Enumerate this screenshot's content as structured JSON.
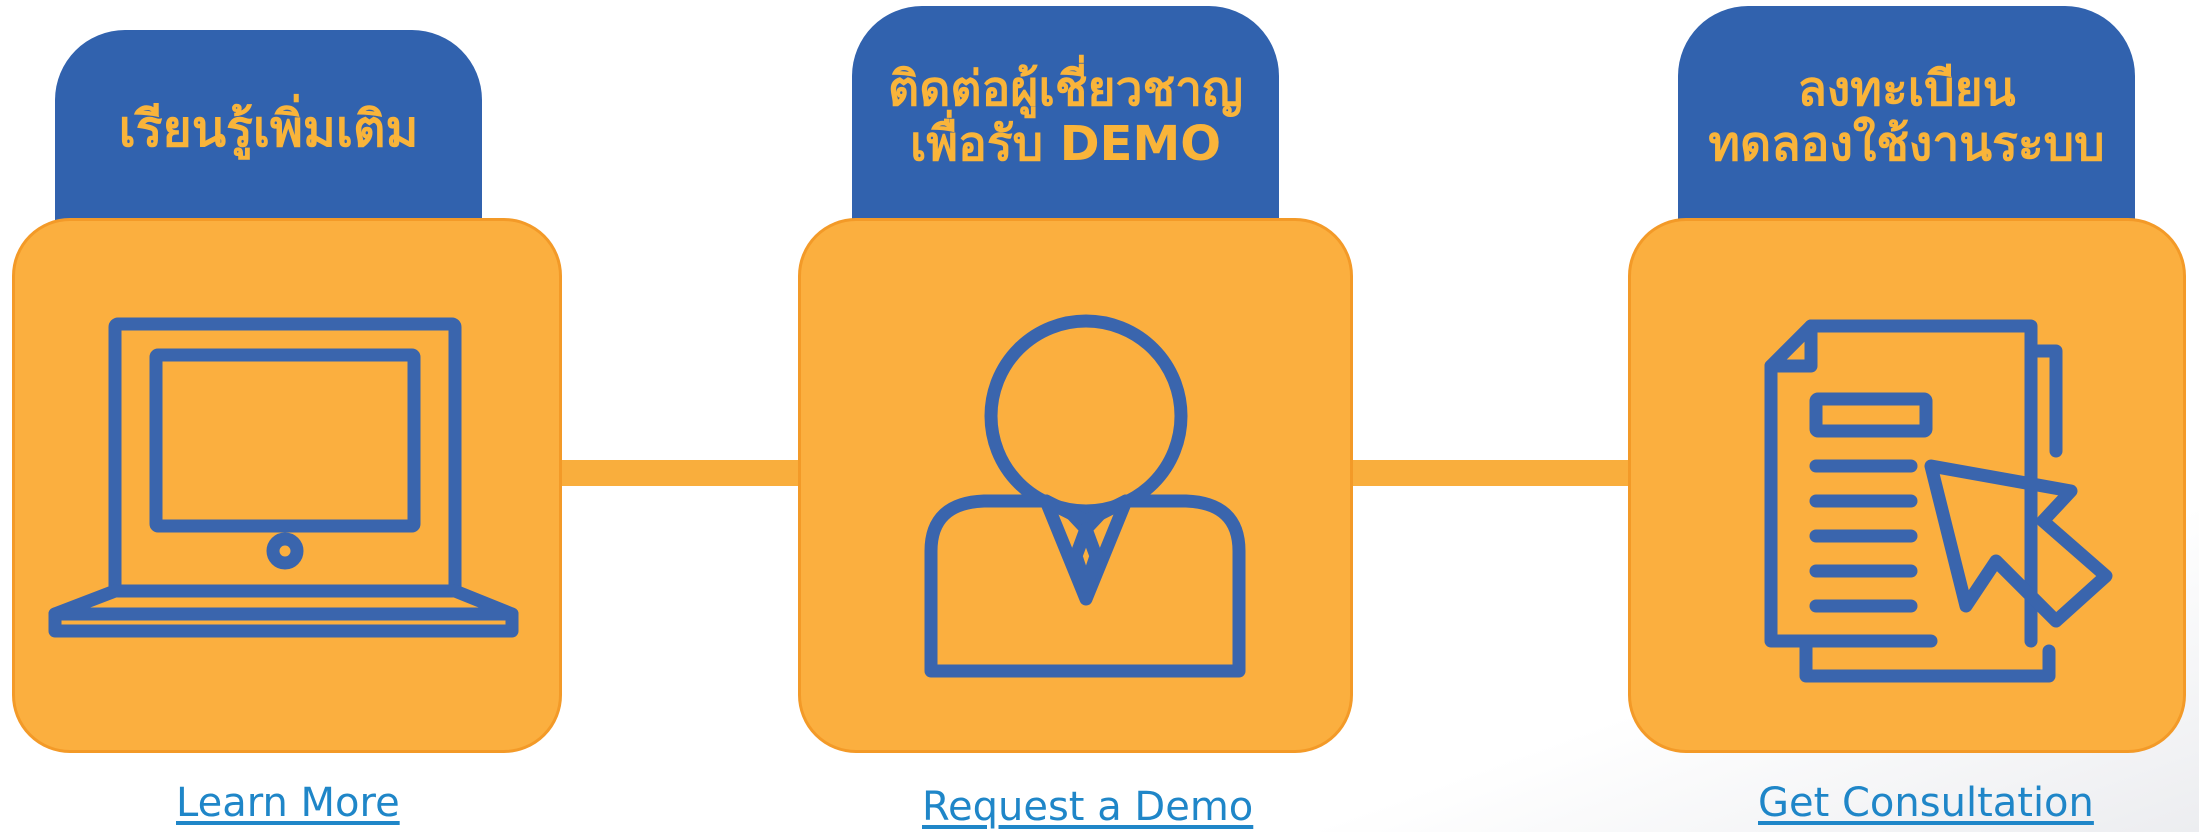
{
  "steps": [
    {
      "title_lines": [
        "เรียนรู้เพิ่มเติม"
      ],
      "link_label": "Learn More",
      "icon": "laptop-icon"
    },
    {
      "title_lines": [
        "ติดต่อผู้เชี่ยวชาญ",
        "เพื่อรับ DEMO"
      ],
      "link_label": "Request a Demo",
      "icon": "person-icon"
    },
    {
      "title_lines": [
        "ลงทะเบียน",
        "ทดลองใช้งานระบบ"
      ],
      "link_label": "Get Consultation",
      "icon": "document-cursor-icon"
    }
  ],
  "colors": {
    "tab_blue": "#3162ae",
    "tile_orange": "#fbaf3f",
    "title_yellow": "#f9b43a",
    "icon_blue": "#3a65ad",
    "link_blue": "#1f86c8"
  }
}
